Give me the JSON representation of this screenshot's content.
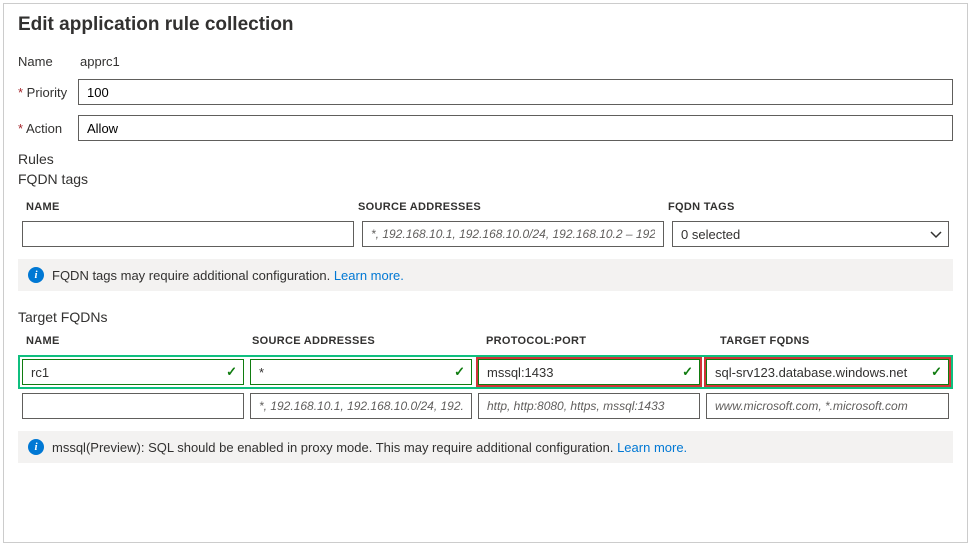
{
  "title": "Edit application rule collection",
  "form": {
    "name_label": "Name",
    "name_value": "apprc1",
    "priority_label": "Priority",
    "priority_value": "100",
    "action_label": "Action",
    "action_value": "Allow"
  },
  "rules_label": "Rules",
  "fqdn_tags": {
    "label": "FQDN tags",
    "headers": {
      "name": "NAME",
      "src": "SOURCE ADDRESSES",
      "tags": "FQDN TAGS"
    },
    "row": {
      "name_value": "",
      "src_placeholder": "*, 192.168.10.1, 192.168.10.0/24, 192.168.10.2 – 192.168…",
      "tags_value": "0 selected"
    },
    "info": {
      "text": "FQDN tags may require additional configuration. ",
      "link": "Learn more."
    }
  },
  "target_fqdns": {
    "label": "Target FQDNs",
    "headers": {
      "name": "NAME",
      "src": "SOURCE ADDRESSES",
      "proto": "PROTOCOL:PORT",
      "target": "TARGET FQDNS"
    },
    "row1": {
      "name": "rc1",
      "src": "*",
      "proto": "mssql:1433",
      "target": "sql-srv123.database.windows.net"
    },
    "row2_placeholders": {
      "name": "",
      "src": "*, 192.168.10.1, 192.168.10.0/24, 192.16…",
      "proto": "http, http:8080, https, mssql:1433",
      "target": "www.microsoft.com, *.microsoft.com"
    },
    "info": {
      "text": "mssql(Preview): SQL should be enabled in proxy mode. This may require additional configuration. ",
      "link": "Learn more."
    }
  }
}
